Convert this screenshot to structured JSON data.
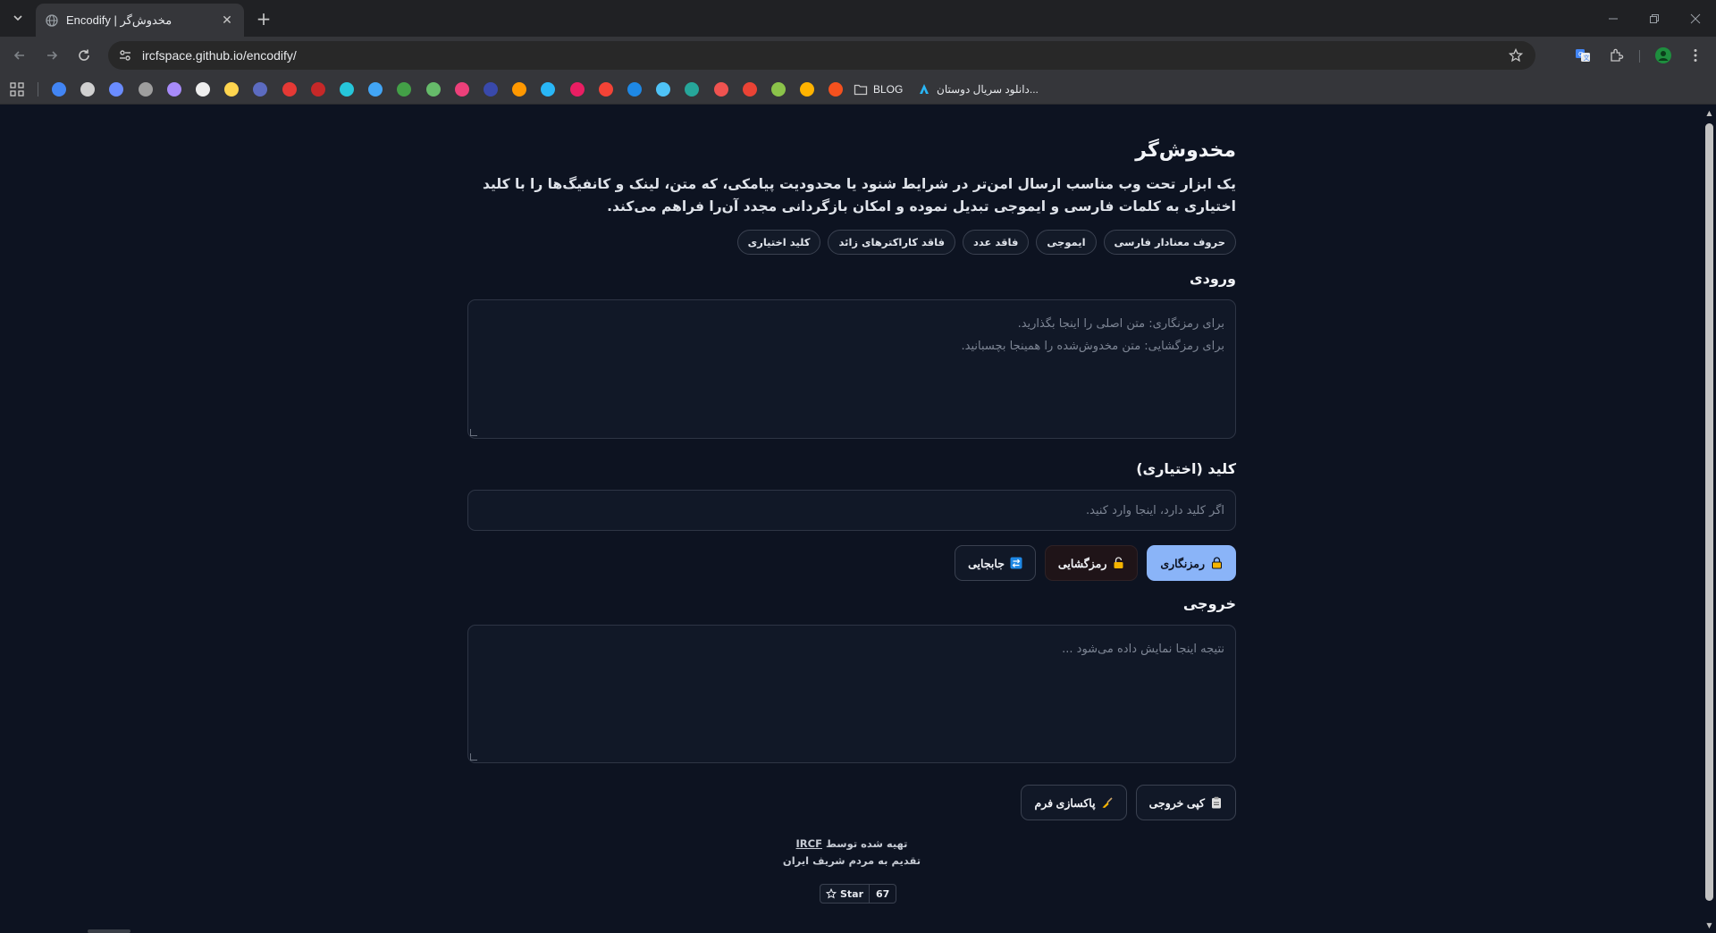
{
  "browser": {
    "tab_title": "Encodify | مخدوش‌گر",
    "url": "ircfspace.github.io/encodify/",
    "bookmarks": {
      "folder_label": "BLOG",
      "link_label": "دانلود سریال دوستان...",
      "icon_colors": [
        "#4285f4",
        "#d0d0d0",
        "#6a8cff",
        "#9e9e9e",
        "#a78bfa",
        "#eeeeee",
        "#ffd54f",
        "#5c6bc0",
        "#e53935",
        "#c62828",
        "#26c6da",
        "#42a5f5",
        "#43a047",
        "#66bb6a",
        "#ec407a",
        "#3949ab",
        "#ff9800",
        "#29b6f6",
        "#e91e63",
        "#f44336",
        "#1e88e5",
        "#4fc3f7",
        "#26a69a",
        "#ef5350",
        "#ea4335",
        "#8bc34a",
        "#ffb300",
        "#f4511e"
      ]
    }
  },
  "page": {
    "title": "مخدوش‌گر",
    "description": "یک ابزار تحت وب مناسب ارسال امن‌تر در شرایط شنود یا محدودیت پیامکی، که متن، لینک و کانفیگ‌ها را با کلید اختیاری به کلمات فارسی و ایموجی تبدیل نموده و امکان بازگردانی مجدد آن‌را فراهم می‌کند.",
    "chips": [
      "حروف معنادار فارسی",
      "ایموجی",
      "فاقد عدد",
      "فاقد کاراکترهای زائد",
      "کلید اختیاری"
    ],
    "input": {
      "label": "ورودی",
      "placeholder_line1": "برای رمزنگاری: متن اصلی را اینجا بگذارید.",
      "placeholder_line2": "برای رمزگشایی: متن مخدوش‌شده را همینجا بچسبانید."
    },
    "key": {
      "label": "کلید (اختیاری)",
      "placeholder": "اگر کلید دارد، اینجا وارد کنید."
    },
    "actions": {
      "encrypt": "رمزنگاری",
      "decrypt": "رمزگشایی",
      "swap": "جابجایی"
    },
    "output": {
      "label": "خروجی",
      "placeholder": "نتیجه اینجا نمایش داده می‌شود ..."
    },
    "output_actions": {
      "copy": "کپی خروجی",
      "clear": "پاکسازی فرم"
    },
    "footer": {
      "made_by_prefix": "تهیه شده توسط",
      "author": "IRCF",
      "dedication": "تقدیم به مردم شریف ایران",
      "star_label": "Star",
      "star_count": "67"
    }
  },
  "colors": {
    "background": "#0d1321",
    "primary": "#8ab4f8",
    "field_bg": "#111827"
  }
}
